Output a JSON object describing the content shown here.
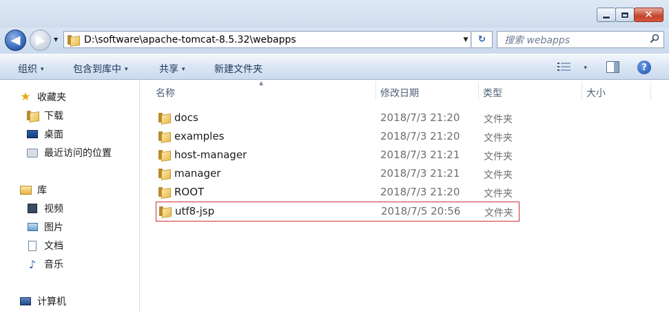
{
  "window": {
    "minimize_glyph": "",
    "maximize_glyph": "",
    "close_glyph": "✕"
  },
  "address": {
    "path": "D:\\software\\apache-tomcat-8.5.32\\webapps",
    "back_glyph": "◀",
    "forward_glyph": "▶",
    "dropdown_glyph": "▼",
    "refresh_glyph": "↻"
  },
  "search": {
    "placeholder": "搜索 webapps",
    "icon": "search-icon"
  },
  "toolbar": {
    "organize": "组织",
    "include_library": "包含到库中",
    "share": "共享",
    "new_folder": "新建文件夹",
    "caret": "▾",
    "help": "?"
  },
  "sidebar": {
    "favorites": "收藏夹",
    "downloads": "下载",
    "desktop": "桌面",
    "recent": "最近访问的位置",
    "libraries": "库",
    "videos": "视频",
    "pictures": "图片",
    "documents": "文档",
    "music": "音乐",
    "computer": "计算机"
  },
  "columns": {
    "name": "名称",
    "modified": "修改日期",
    "type": "类型",
    "size": "大小"
  },
  "files": [
    {
      "name": "docs",
      "date": "2018/7/3 21:20",
      "type": "文件夹"
    },
    {
      "name": "examples",
      "date": "2018/7/3 21:20",
      "type": "文件夹"
    },
    {
      "name": "host-manager",
      "date": "2018/7/3 21:21",
      "type": "文件夹"
    },
    {
      "name": "manager",
      "date": "2018/7/3 21:21",
      "type": "文件夹"
    },
    {
      "name": "ROOT",
      "date": "2018/7/3 21:20",
      "type": "文件夹"
    },
    {
      "name": "utf8-jsp",
      "date": "2018/7/5 20:56",
      "type": "文件夹"
    }
  ],
  "colors": {
    "highlight_border": "#d02d36",
    "accent": "#1e395b"
  }
}
